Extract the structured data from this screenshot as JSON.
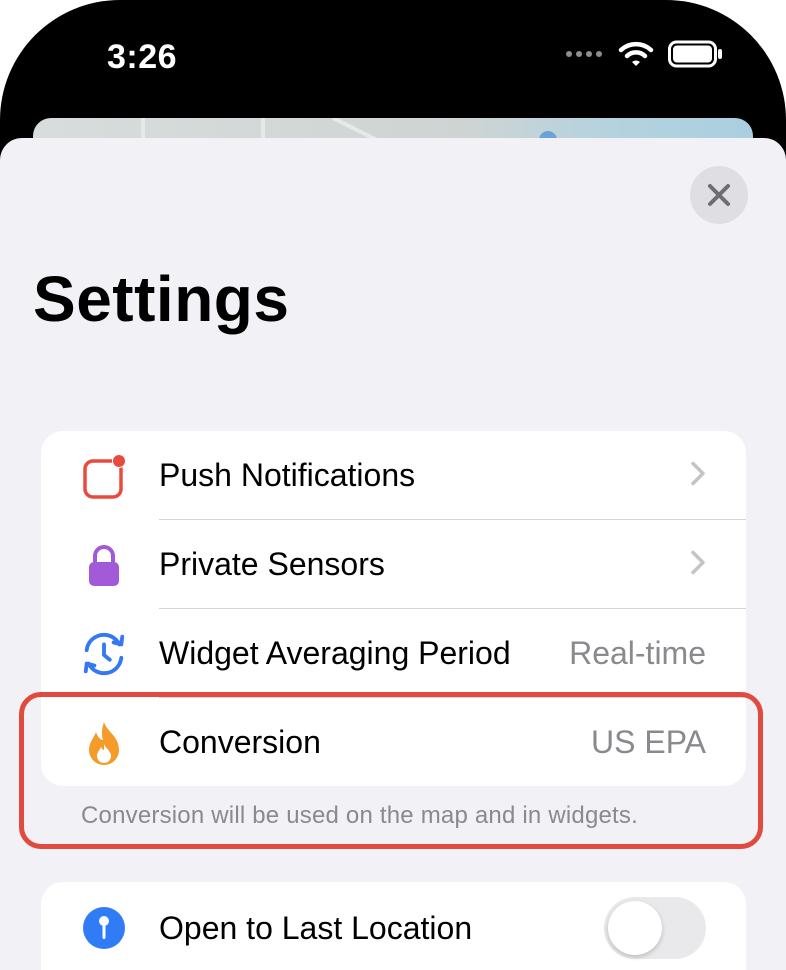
{
  "status_bar": {
    "time": "3:26"
  },
  "header": {
    "title": "Settings"
  },
  "section1": {
    "rows": [
      {
        "label": "Push Notifications",
        "icon": "notification-badge-icon"
      },
      {
        "label": "Private Sensors",
        "icon": "lock-icon"
      },
      {
        "label": "Widget Averaging Period",
        "value": "Real-time",
        "icon": "clock-arrows-icon"
      },
      {
        "label": "Conversion",
        "value": "US EPA",
        "icon": "flame-icon"
      }
    ],
    "footnote": "Conversion will be used on the map and in widgets."
  },
  "section2": {
    "rows": [
      {
        "label": "Open to Last Location",
        "icon": "location-pin-icon",
        "toggle_on": false
      }
    ]
  },
  "colors": {
    "accent_red": "#e04a3f",
    "lock_purple": "#a25ad9",
    "clock_blue": "#3478f6",
    "flame_orange": "#f59b2a",
    "pin_blue": "#2f7cf6"
  }
}
